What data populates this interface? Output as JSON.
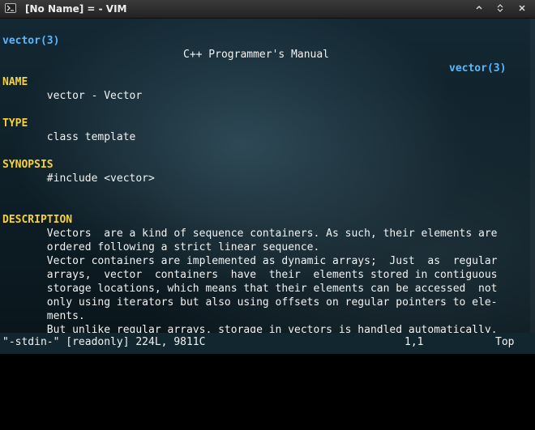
{
  "window": {
    "title": "[No Name] = - VIM",
    "controls": [
      "restore-icon",
      "maximize-icon",
      "close-icon"
    ]
  },
  "header": {
    "left": "vector(3)",
    "center": "C++ Programmer's Manual",
    "right": "vector(3)"
  },
  "sections": {
    "name": {
      "heading": "NAME",
      "lines": [
        "       vector - Vector"
      ]
    },
    "type": {
      "heading": "TYPE",
      "lines": [
        "       class template"
      ]
    },
    "synopsis": {
      "heading": "SYNOPSIS",
      "lines": [
        "       #include <vector>"
      ]
    },
    "description": {
      "heading": "DESCRIPTION",
      "lines": [
        "       Vectors  are a kind of sequence containers. As such, their elements are",
        "       ordered following a strict linear sequence.",
        "       Vector containers are implemented as dynamic arrays;  Just  as  regular",
        "       arrays,  vector  containers  have  their  elements stored in contiguous",
        "       storage locations, which means that their elements can be accessed  not",
        "       only using iterators but also using offsets on regular pointers to ele-",
        "       ments.",
        "       But unlike regular arrays, storage in vectors is handled automatically,"
      ]
    }
  },
  "statusline": {
    "file": "\"-stdin-\" [readonly] 224L, 9811C",
    "position": "1,1",
    "scroll": "Top"
  },
  "colors": {
    "heading": "#f5d23a",
    "header_ref": "#59b7ff",
    "text": "#f2f2f2",
    "background": "#0d1e26"
  }
}
